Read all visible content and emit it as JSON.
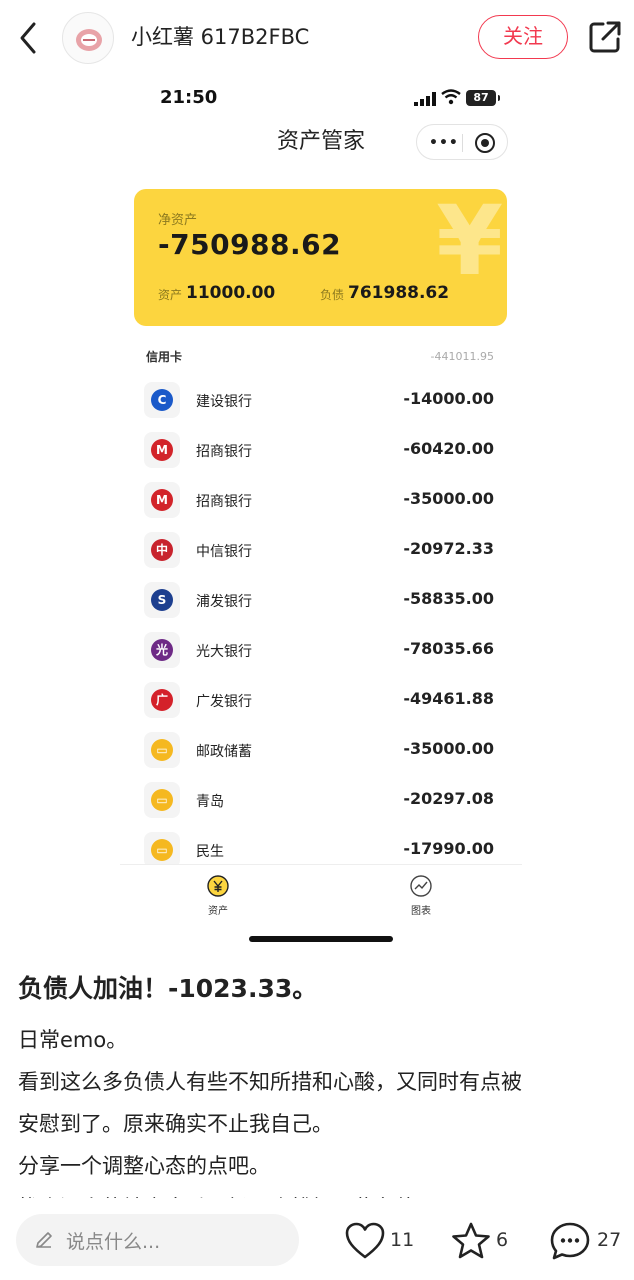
{
  "header": {
    "author": "小红薯 617B2FBC",
    "follow_label": "关注"
  },
  "phone": {
    "time": "21:50",
    "battery": "87",
    "app_title": "资产管家",
    "summary": {
      "net_label": "净资产",
      "net_value": "-750988.62",
      "assets_label": "资产",
      "assets_value": "11000.00",
      "liab_label": "负债",
      "liab_value": "761988.62"
    },
    "section": {
      "title": "信用卡",
      "total": "-441011.95"
    },
    "accounts": [
      {
        "name": "建设银行",
        "amount": "-14000.00",
        "icon": "ccb-icon",
        "color": "#1a59c9"
      },
      {
        "name": "招商银行",
        "amount": "-60420.00",
        "icon": "cmb-icon",
        "color": "#d2242a"
      },
      {
        "name": "招商银行",
        "amount": "-35000.00",
        "icon": "cmb-icon",
        "color": "#d2242a"
      },
      {
        "name": "中信银行",
        "amount": "-20972.33",
        "icon": "citic-icon",
        "color": "#c8232d"
      },
      {
        "name": "浦发银行",
        "amount": "-58835.00",
        "icon": "spdb-icon",
        "color": "#1d3f8f"
      },
      {
        "name": "光大银行",
        "amount": "-78035.66",
        "icon": "ceb-icon",
        "color": "#6e2a86"
      },
      {
        "name": "广发银行",
        "amount": "-49461.88",
        "icon": "cgb-icon",
        "color": "#d4212a"
      },
      {
        "name": "邮政储蓄",
        "amount": "-35000.00",
        "icon": "card-icon",
        "color": "#f5b820"
      },
      {
        "name": "青岛",
        "amount": "-20297.08",
        "icon": "card-icon",
        "color": "#f5b820"
      },
      {
        "name": "民生",
        "amount": "-17990.00",
        "icon": "card-icon",
        "color": "#f5b820"
      }
    ],
    "tabs": [
      {
        "label": "资产",
        "icon": "yen-icon"
      },
      {
        "label": "图表",
        "icon": "chart-icon"
      }
    ]
  },
  "post": {
    "title": "负债人加油！-1023.33。",
    "lines": [
      "日常emo。",
      "看到这么多负债人有些不知所措和心酸，又同时有点被",
      "安慰到了。原来确实不止我自己。",
      "分享一个调整心态的点吧。",
      "找个没人的地方大吼一场，会排解一些负能量"
    ]
  },
  "bottom": {
    "comment_placeholder": "说点什么...",
    "likes": "11",
    "favorites": "6",
    "comments": "27"
  },
  "colors": {
    "accent": "#f2394f",
    "card": "#fcd53f"
  }
}
